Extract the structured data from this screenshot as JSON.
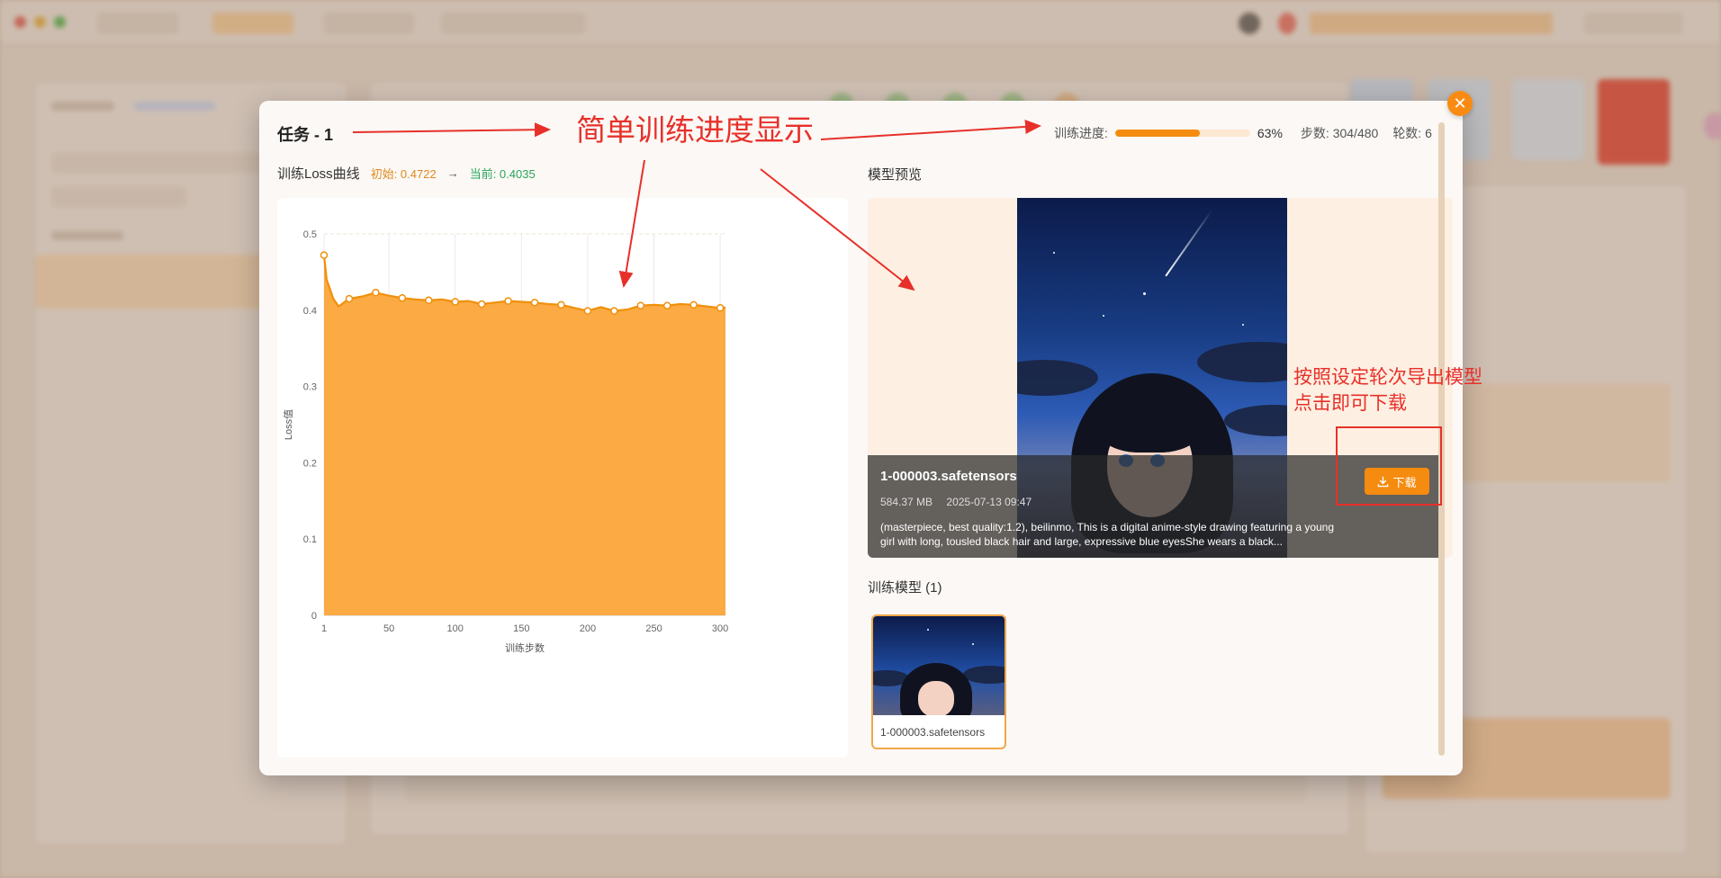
{
  "modal": {
    "title": "任务 - 1",
    "progress_label": "训练进度:",
    "progress_percent": 63,
    "progress_percent_text": "63%",
    "steps_text": "步数: 304/480",
    "epochs_text": "轮数: 6",
    "close_icon": "close-icon"
  },
  "loss": {
    "heading": "训练Loss曲线",
    "initial_text": "初始: 0.4722",
    "arrow": "→",
    "current_text": "当前: 0.4035"
  },
  "chart_data": {
    "type": "area",
    "title": "",
    "xlabel": "训练步数",
    "ylabel": "Loss值",
    "xlim": [
      1,
      304
    ],
    "ylim": [
      0,
      0.5
    ],
    "x_ticks": [
      1,
      50,
      100,
      150,
      200,
      250,
      300
    ],
    "y_ticks": [
      0,
      0.1,
      0.2,
      0.3,
      0.4,
      0.5
    ],
    "grid": true,
    "fill_color": "#fbaa44",
    "line_color": "#f0900a",
    "series": [
      {
        "x": [
          1,
          3,
          5,
          8,
          12,
          20,
          30,
          40,
          50,
          60,
          70,
          80,
          90,
          100,
          110,
          120,
          130,
          140,
          150,
          160,
          170,
          180,
          190,
          200,
          210,
          220,
          230,
          240,
          250,
          260,
          270,
          280,
          290,
          300,
          304
        ],
        "y": [
          0.4722,
          0.44,
          0.43,
          0.415,
          0.405,
          0.415,
          0.418,
          0.423,
          0.419,
          0.416,
          0.414,
          0.413,
          0.414,
          0.411,
          0.412,
          0.408,
          0.41,
          0.412,
          0.411,
          0.41,
          0.408,
          0.407,
          0.403,
          0.399,
          0.404,
          0.399,
          0.401,
          0.406,
          0.407,
          0.406,
          0.408,
          0.407,
          0.405,
          0.403,
          0.4035
        ],
        "marker_x": [
          1,
          20,
          40,
          60,
          80,
          100,
          120,
          140,
          160,
          180,
          200,
          220,
          240,
          260,
          280,
          300
        ],
        "marker_y": [
          0.4722,
          0.415,
          0.423,
          0.416,
          0.413,
          0.411,
          0.408,
          0.412,
          0.41,
          0.407,
          0.399,
          0.399,
          0.406,
          0.406,
          0.407,
          0.403
        ]
      }
    ]
  },
  "preview": {
    "heading": "模型预览",
    "file_name": "1-000003.safetensors",
    "size": "584.37 MB",
    "date": "2025-07-13 09:47",
    "prompt": "(masterpiece, best quality:1.2), beilinmo, This is a digital anime-style drawing featuring a young girl with long, tousled black hair and large, expressive blue eyesShe wears a black...",
    "download_label": "下载",
    "download_icon": "download-icon"
  },
  "trained_models": {
    "heading": "训练模型 (1)",
    "items": [
      {
        "label": "1-000003.safetensors"
      }
    ]
  },
  "annotations": {
    "title": "简单训练进度显示",
    "side_line1": "按照设定轮次导出模型",
    "side_line2": "点击即可下载"
  }
}
